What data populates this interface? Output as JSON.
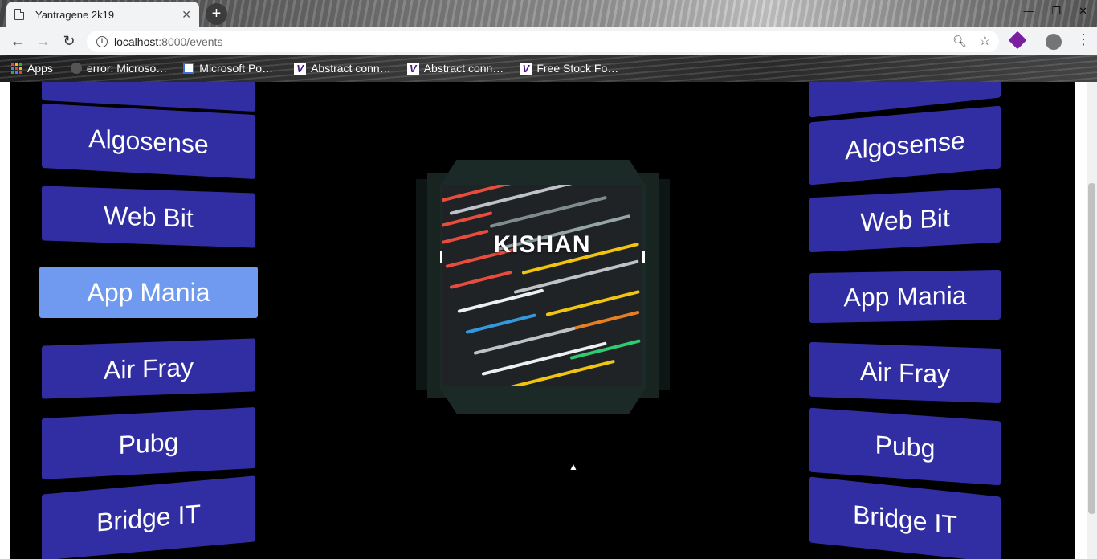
{
  "browser": {
    "tab_title": "Yantragene 2k19",
    "url_host": "localhost",
    "url_path": ":8000/events",
    "bookmarks": [
      {
        "label": "Apps",
        "icon": "apps-grid-icon"
      },
      {
        "label": "error: Microso…",
        "icon": "github-icon"
      },
      {
        "label": "Microsoft Po…",
        "icon": "microsoft-icon"
      },
      {
        "label": "Abstract conn…",
        "icon": "v-icon"
      },
      {
        "label": "Abstract conn…",
        "icon": "v-icon"
      },
      {
        "label": "Free Stock Fo…",
        "icon": "v-icon"
      }
    ]
  },
  "events": {
    "left": [
      "Algosense",
      "Web Bit",
      "App Mania",
      "Air Fray",
      "Pubg",
      "Bridge IT"
    ],
    "right": [
      "Algosense",
      "Web Bit",
      "App Mania",
      "Air Fray",
      "Pubg",
      "Bridge IT"
    ],
    "active": "App Mania"
  },
  "cube": {
    "title": "KISHAN"
  },
  "colors": {
    "event_button": "#312ea3",
    "event_button_active": "#6f9af0",
    "page_background": "#000000"
  }
}
